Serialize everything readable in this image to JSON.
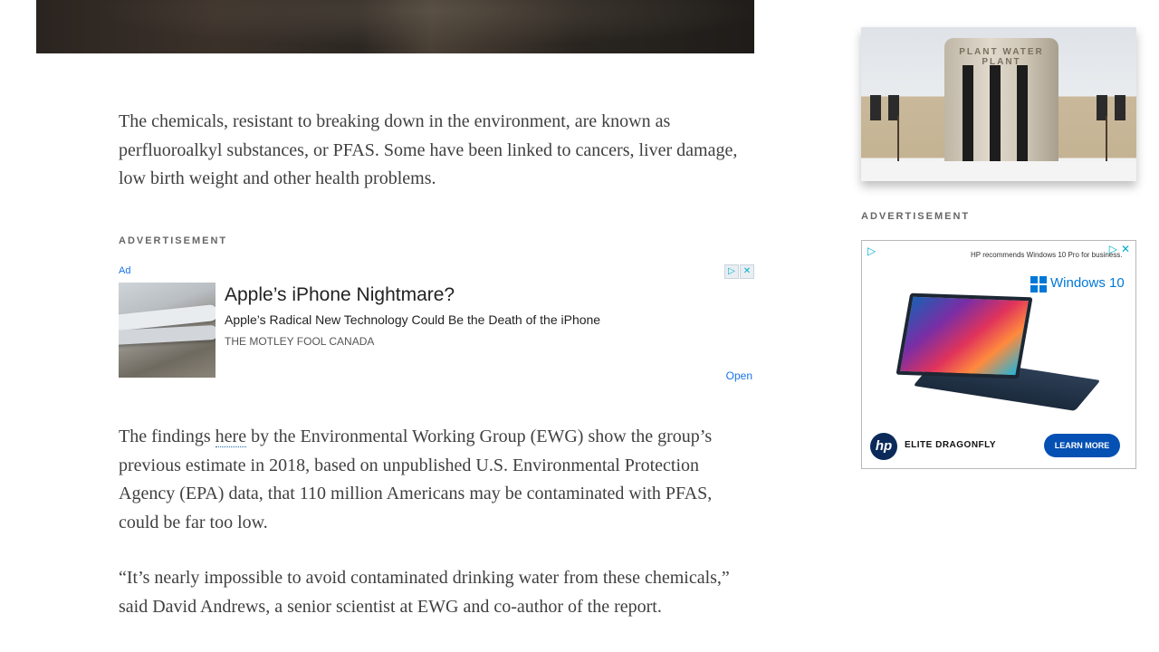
{
  "article": {
    "paragraph1": "The chemicals, resistant to breaking down in the environment, are known as perfluoroalkyl substances, or PFAS. Some have been linked to cancers, liver damage, low birth weight and other health problems.",
    "paragraph2_before_link": "The findings ",
    "paragraph2_link": "here",
    "paragraph2_after_link": " by the Environmental Working Group (EWG) show the group’s previous estimate in 2018, based on unpublished U.S. Environmental Protection Agency (EPA) data, that 110 million Americans may be contaminated with PFAS, could be far too low.",
    "paragraph3": "“It’s nearly impossible to avoid contaminated drinking water from these chemicals,” said David Andrews, a senior scientist at EWG and co-author of the report."
  },
  "ads": {
    "label": "ADVERTISEMENT",
    "native": {
      "badge": "Ad",
      "title": "Apple’s iPhone Nightmare?",
      "description": "Apple’s Radical New Technology Could Be the Death of the iPhone",
      "source": "THE MOTLEY FOOL CANADA",
      "open": "Open"
    },
    "sidebar": {
      "top_note": "HP recommends Windows 10 Pro for business.",
      "os_label": "Windows 10",
      "brand": "hp",
      "product": "ELITE DRAGONFLY",
      "cta": "LEARN MORE"
    }
  },
  "sidebar_photo": {
    "sign_text": "PLANT WATER PLANT"
  },
  "colors": {
    "text": "#404040",
    "link_underline": "#1c6aa8",
    "ad_blue": "#1a73e8",
    "hp_button": "#0550b3"
  },
  "icons": [
    "ad-choices-icon",
    "close-icon",
    "windows-logo-icon",
    "hp-logo-icon"
  ]
}
